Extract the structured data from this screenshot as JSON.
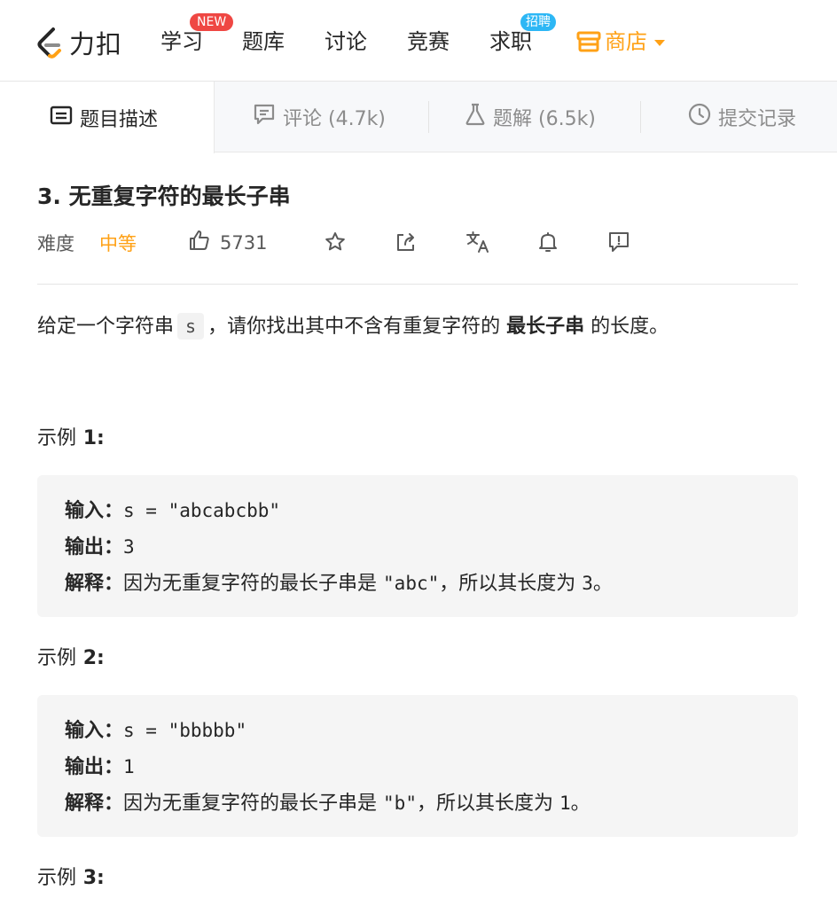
{
  "nav": {
    "logo_text": "力扣",
    "items": [
      {
        "label": "学习",
        "badge": "NEW"
      },
      {
        "label": "题库"
      },
      {
        "label": "讨论"
      },
      {
        "label": "竞赛"
      },
      {
        "label": "求职",
        "badge": "招聘"
      },
      {
        "label": "商店"
      }
    ],
    "accent_color": "#ffa116"
  },
  "tabs": [
    {
      "label": "题目描述",
      "icon": "description-icon",
      "active": true
    },
    {
      "label": "评论 (4.7k)",
      "icon": "comment-icon"
    },
    {
      "label": "题解 (6.5k)",
      "icon": "flask-icon"
    },
    {
      "label": "提交记录",
      "icon": "clock-icon"
    }
  ],
  "problem": {
    "title": "3. 无重复字符的最长子串",
    "difficulty_label": "难度",
    "difficulty": "中等",
    "likes": "5731",
    "description": {
      "pre": "给定一个字符串",
      "code": "s",
      "mid": "，请你找出其中不含有重复字符的",
      "bold": "最长子串",
      "post": "的长度。"
    },
    "examples": [
      {
        "title_label": "示例",
        "title_num": "1:",
        "input_label": "输入：",
        "input": "s = \"abcabcbb\"",
        "output_label": "输出：",
        "output": "3",
        "explain_label": "解释：",
        "explain_pre": "因为无重复字符的最长子串是",
        "explain_code": "\"abc\"",
        "explain_post": "，所以其长度为",
        "explain_num": "3",
        "explain_end": "。"
      },
      {
        "title_label": "示例",
        "title_num": "2:",
        "input_label": "输入：",
        "input": "s = \"bbbbb\"",
        "output_label": "输出：",
        "output": "1",
        "explain_label": "解释：",
        "explain_pre": "因为无重复字符的最长子串是",
        "explain_code": "\"b\"",
        "explain_post": "，所以其长度为",
        "explain_num": "1",
        "explain_end": "。"
      },
      {
        "title_label": "示例",
        "title_num": "3:"
      }
    ]
  }
}
